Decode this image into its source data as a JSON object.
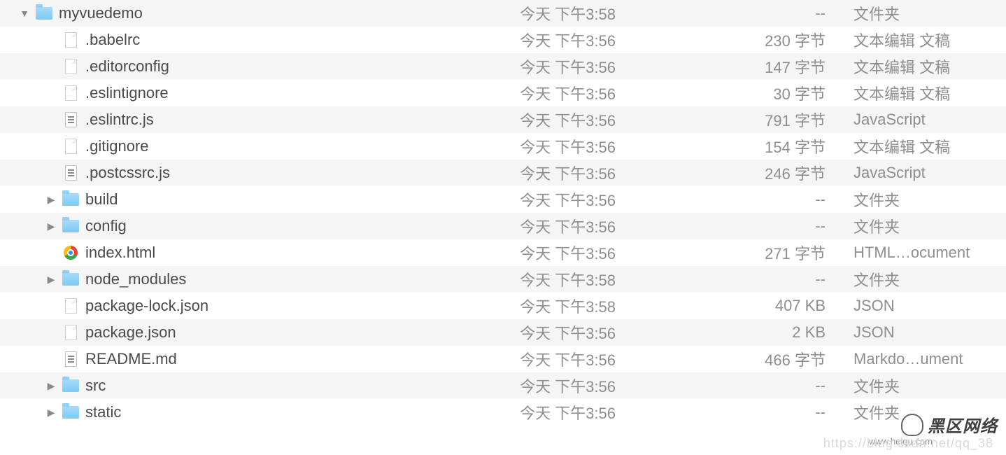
{
  "watermark": {
    "brand": "黑区网络",
    "url": "www.heiqu.com",
    "faint": "https://blog.csdn.net/qq_38"
  },
  "rows": [
    {
      "indent": 0,
      "arrow": "down",
      "icon": "folder",
      "name": "myvuedemo",
      "date": "今天 下午3:58",
      "size": "--",
      "kind": "文件夹"
    },
    {
      "indent": 1,
      "arrow": "",
      "icon": "blank",
      "name": ".babelrc",
      "date": "今天 下午3:56",
      "size": "230 字节",
      "kind": "文本编辑 文稿"
    },
    {
      "indent": 1,
      "arrow": "",
      "icon": "blank",
      "name": ".editorconfig",
      "date": "今天 下午3:56",
      "size": "147 字节",
      "kind": "文本编辑 文稿"
    },
    {
      "indent": 1,
      "arrow": "",
      "icon": "blank",
      "name": ".eslintignore",
      "date": "今天 下午3:56",
      "size": "30 字节",
      "kind": "文本编辑 文稿"
    },
    {
      "indent": 1,
      "arrow": "",
      "icon": "js",
      "name": ".eslintrc.js",
      "date": "今天 下午3:56",
      "size": "791 字节",
      "kind": "JavaScript"
    },
    {
      "indent": 1,
      "arrow": "",
      "icon": "blank",
      "name": ".gitignore",
      "date": "今天 下午3:56",
      "size": "154 字节",
      "kind": "文本编辑 文稿"
    },
    {
      "indent": 1,
      "arrow": "",
      "icon": "js",
      "name": ".postcssrc.js",
      "date": "今天 下午3:56",
      "size": "246 字节",
      "kind": "JavaScript"
    },
    {
      "indent": 1,
      "arrow": "right",
      "icon": "folder",
      "name": "build",
      "date": "今天 下午3:56",
      "size": "--",
      "kind": "文件夹"
    },
    {
      "indent": 1,
      "arrow": "right",
      "icon": "folder",
      "name": "config",
      "date": "今天 下午3:56",
      "size": "--",
      "kind": "文件夹"
    },
    {
      "indent": 1,
      "arrow": "",
      "icon": "chrome",
      "name": "index.html",
      "date": "今天 下午3:56",
      "size": "271 字节",
      "kind": "HTML…ocument"
    },
    {
      "indent": 1,
      "arrow": "right",
      "icon": "folder",
      "name": "node_modules",
      "date": "今天 下午3:58",
      "size": "--",
      "kind": "文件夹"
    },
    {
      "indent": 1,
      "arrow": "",
      "icon": "blank",
      "name": "package-lock.json",
      "date": "今天 下午3:58",
      "size": "407 KB",
      "kind": "JSON"
    },
    {
      "indent": 1,
      "arrow": "",
      "icon": "blank",
      "name": "package.json",
      "date": "今天 下午3:56",
      "size": "2 KB",
      "kind": "JSON"
    },
    {
      "indent": 1,
      "arrow": "",
      "icon": "md",
      "name": "README.md",
      "date": "今天 下午3:56",
      "size": "466 字节",
      "kind": "Markdo…ument"
    },
    {
      "indent": 1,
      "arrow": "right",
      "icon": "folder",
      "name": "src",
      "date": "今天 下午3:56",
      "size": "--",
      "kind": "文件夹"
    },
    {
      "indent": 1,
      "arrow": "right",
      "icon": "folder",
      "name": "static",
      "date": "今天 下午3:56",
      "size": "--",
      "kind": "文件夹"
    }
  ]
}
